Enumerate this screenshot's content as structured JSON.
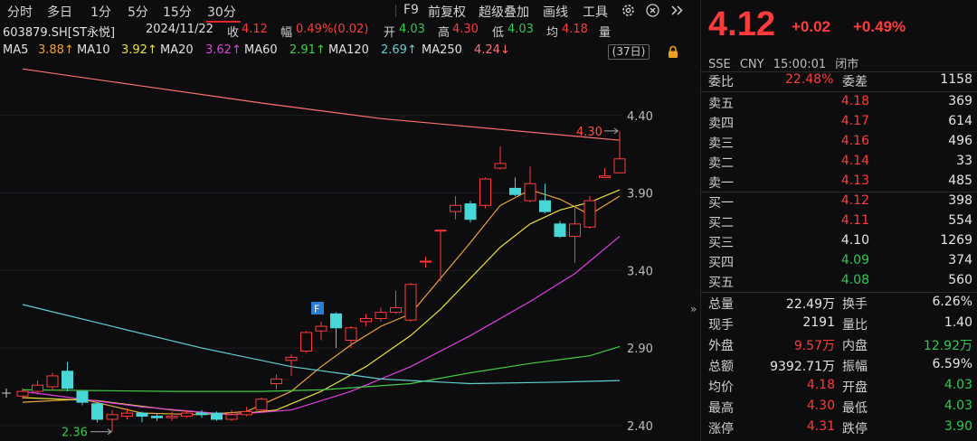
{
  "toolbar": {
    "periods": [
      "分时",
      "多日",
      "1分",
      "5分",
      "15分",
      "30分"
    ],
    "right_items": [
      "F9",
      "前复权",
      "超级叠加",
      "画线",
      "工具"
    ]
  },
  "info": {
    "code": "603879.SH[ST永悦]",
    "date": "2024/11/22",
    "close_label": "收",
    "close_value": "4.12",
    "amp_label": "幅",
    "amp_value": "0.49%(0.02)",
    "open_label": "开",
    "open_value": "4.03",
    "high_label": "高",
    "high_value": "4.30",
    "low_label": "低",
    "low_value": "4.03",
    "avg_label": "均",
    "avg_value": "4.18",
    "vol_label": "量"
  },
  "ma": [
    {
      "label": "MA5",
      "value": "3.88↑",
      "color": "#e8a33c"
    },
    {
      "label": "MA10",
      "value": "3.92↑",
      "color": "#e8e03c"
    },
    {
      "label": "MA20",
      "value": "3.62↑",
      "color": "#e040e0"
    },
    {
      "label": "MA60",
      "value": "2.91↑",
      "color": "#44cc44"
    },
    {
      "label": "MA120",
      "value": "2.69↑",
      "color": "#5fd0d0"
    },
    {
      "label": "MA250",
      "value": "4.24↓",
      "color": "#ff7070"
    }
  ],
  "days_badge": "(37日)",
  "chart_data": {
    "type": "candlestick",
    "y_ticks": [
      "4.40",
      "3.90",
      "3.40",
      "2.90",
      "2.40"
    ],
    "ylim": [
      2.3,
      4.76
    ],
    "high_marker": "4.30",
    "low_marker": "2.36",
    "f_marker": "F",
    "candles": [
      {
        "o": 2.59,
        "c": 2.62,
        "h": 2.64,
        "l": 2.57
      },
      {
        "o": 2.62,
        "c": 2.66,
        "h": 2.69,
        "l": 2.6
      },
      {
        "o": 2.65,
        "c": 2.72,
        "h": 2.74,
        "l": 2.63
      },
      {
        "o": 2.75,
        "c": 2.64,
        "h": 2.81,
        "l": 2.62
      },
      {
        "o": 2.62,
        "c": 2.55,
        "h": 2.63,
        "l": 2.53
      },
      {
        "o": 2.54,
        "c": 2.44,
        "h": 2.55,
        "l": 2.42
      },
      {
        "o": 2.44,
        "c": 2.47,
        "h": 2.5,
        "l": 2.36
      },
      {
        "o": 2.46,
        "c": 2.48,
        "h": 2.51,
        "l": 2.44
      },
      {
        "o": 2.48,
        "c": 2.46,
        "h": 2.49,
        "l": 2.42
      },
      {
        "o": 2.46,
        "c": 2.45,
        "h": 2.48,
        "l": 2.43
      },
      {
        "o": 2.45,
        "c": 2.46,
        "h": 2.49,
        "l": 2.43
      },
      {
        "o": 2.46,
        "c": 2.48,
        "h": 2.5,
        "l": 2.45
      },
      {
        "o": 2.48,
        "c": 2.47,
        "h": 2.5,
        "l": 2.45
      },
      {
        "o": 2.48,
        "c": 2.44,
        "h": 2.49,
        "l": 2.43
      },
      {
        "o": 2.44,
        "c": 2.47,
        "h": 2.5,
        "l": 2.43
      },
      {
        "o": 2.47,
        "c": 2.49,
        "h": 2.52,
        "l": 2.46
      },
      {
        "o": 2.5,
        "c": 2.57,
        "h": 2.58,
        "l": 2.48
      },
      {
        "o": 2.67,
        "c": 2.7,
        "h": 2.73,
        "l": 2.63
      },
      {
        "o": 2.82,
        "c": 2.84,
        "h": 2.86,
        "l": 2.72
      },
      {
        "o": 2.88,
        "c": 3.0,
        "h": 3.01,
        "l": 2.87
      },
      {
        "o": 3.01,
        "c": 3.04,
        "h": 3.07,
        "l": 2.95
      },
      {
        "o": 3.12,
        "c": 3.03,
        "h": 3.13,
        "l": 2.9
      },
      {
        "o": 2.95,
        "c": 3.03,
        "h": 3.04,
        "l": 2.9
      },
      {
        "o": 3.07,
        "c": 3.09,
        "h": 3.12,
        "l": 3.04
      },
      {
        "o": 3.09,
        "c": 3.13,
        "h": 3.16,
        "l": 3.07
      },
      {
        "o": 3.13,
        "c": 3.16,
        "h": 3.27,
        "l": 3.12
      },
      {
        "o": 3.08,
        "c": 3.31,
        "h": 3.32,
        "l": 3.07
      },
      {
        "o": 3.46,
        "c": 3.46,
        "h": 3.49,
        "l": 3.42
      },
      {
        "o": 3.66,
        "c": 3.66,
        "h": 3.66,
        "l": 3.33
      },
      {
        "o": 3.78,
        "c": 3.82,
        "h": 3.88,
        "l": 3.73
      },
      {
        "o": 3.83,
        "c": 3.73,
        "h": 3.85,
        "l": 3.71
      },
      {
        "o": 3.82,
        "c": 3.99,
        "h": 4.0,
        "l": 3.8
      },
      {
        "o": 4.06,
        "c": 4.09,
        "h": 4.2,
        "l": 4.05
      },
      {
        "o": 3.93,
        "c": 3.89,
        "h": 4.0,
        "l": 3.88
      },
      {
        "o": 3.85,
        "c": 3.96,
        "h": 4.07,
        "l": 3.84
      },
      {
        "o": 3.85,
        "c": 3.78,
        "h": 3.96,
        "l": 3.77
      },
      {
        "o": 3.7,
        "c": 3.62,
        "h": 3.72,
        "l": 3.61
      },
      {
        "o": 3.62,
        "c": 3.7,
        "h": 3.82,
        "l": 3.45
      },
      {
        "o": 3.68,
        "c": 3.85,
        "h": 3.88,
        "l": 3.67
      },
      {
        "o": 4.0,
        "c": 4.01,
        "h": 4.06,
        "l": 4.0
      },
      {
        "o": 4.03,
        "c": 4.12,
        "h": 4.3,
        "l": 4.03
      }
    ],
    "ma_lines": [
      {
        "name": "MA5",
        "color": "#e8a33c",
        "points": [
          [
            0,
            2.55
          ],
          [
            4,
            2.57
          ],
          [
            8,
            2.48
          ],
          [
            12,
            2.47
          ],
          [
            15,
            2.49
          ],
          [
            18,
            2.62
          ],
          [
            20,
            2.78
          ],
          [
            22,
            2.92
          ],
          [
            24,
            3.04
          ],
          [
            26,
            3.12
          ],
          [
            28,
            3.35
          ],
          [
            30,
            3.58
          ],
          [
            32,
            3.82
          ],
          [
            34,
            3.92
          ],
          [
            36,
            3.86
          ],
          [
            38,
            3.76
          ],
          [
            40,
            3.88
          ]
        ]
      },
      {
        "name": "MA10",
        "color": "#e8e03c",
        "points": [
          [
            0,
            2.58
          ],
          [
            5,
            2.56
          ],
          [
            10,
            2.5
          ],
          [
            14,
            2.47
          ],
          [
            17,
            2.5
          ],
          [
            20,
            2.62
          ],
          [
            23,
            2.78
          ],
          [
            26,
            2.98
          ],
          [
            28,
            3.15
          ],
          [
            30,
            3.35
          ],
          [
            32,
            3.55
          ],
          [
            34,
            3.7
          ],
          [
            36,
            3.79
          ],
          [
            38,
            3.84
          ],
          [
            40,
            3.92
          ]
        ]
      },
      {
        "name": "MA20",
        "color": "#e040e0",
        "points": [
          [
            0,
            2.62
          ],
          [
            8,
            2.52
          ],
          [
            14,
            2.47
          ],
          [
            18,
            2.5
          ],
          [
            22,
            2.62
          ],
          [
            26,
            2.78
          ],
          [
            30,
            2.98
          ],
          [
            34,
            3.2
          ],
          [
            37,
            3.38
          ],
          [
            40,
            3.62
          ]
        ]
      },
      {
        "name": "MA60",
        "color": "#44cc44",
        "points": [
          [
            0,
            2.63
          ],
          [
            10,
            2.62
          ],
          [
            16,
            2.62
          ],
          [
            20,
            2.63
          ],
          [
            26,
            2.67
          ],
          [
            30,
            2.74
          ],
          [
            34,
            2.8
          ],
          [
            38,
            2.85
          ],
          [
            40,
            2.91
          ]
        ]
      },
      {
        "name": "MA120",
        "color": "#5fd0d0",
        "points": [
          [
            0,
            3.18
          ],
          [
            6,
            3.04
          ],
          [
            12,
            2.9
          ],
          [
            18,
            2.78
          ],
          [
            24,
            2.7
          ],
          [
            30,
            2.67
          ],
          [
            36,
            2.68
          ],
          [
            40,
            2.69
          ]
        ]
      },
      {
        "name": "MA250",
        "color": "#ff7070",
        "points": [
          [
            0,
            4.7
          ],
          [
            8,
            4.59
          ],
          [
            16,
            4.48
          ],
          [
            24,
            4.38
          ],
          [
            32,
            4.31
          ],
          [
            40,
            4.24
          ]
        ]
      }
    ]
  },
  "quote": {
    "price": "4.12",
    "change": "+0.02",
    "change_pct": "+0.49%",
    "market": "SSE",
    "currency": "CNY",
    "time": "15:00:01",
    "status": "闭市",
    "weibi_label": "委比",
    "weibi_value": "22.48%",
    "weicha_label": "委差",
    "weicha_value": "1158",
    "asks": [
      {
        "label": "卖五",
        "price": "4.18",
        "vol": "369",
        "color": "#ff3b3b"
      },
      {
        "label": "卖四",
        "price": "4.17",
        "vol": "614",
        "color": "#ff3b3b"
      },
      {
        "label": "卖三",
        "price": "4.16",
        "vol": "496",
        "color": "#ff3b3b"
      },
      {
        "label": "卖二",
        "price": "4.14",
        "vol": "33",
        "color": "#ff3b3b"
      },
      {
        "label": "卖一",
        "price": "4.13",
        "vol": "485",
        "color": "#ff3b3b"
      }
    ],
    "bids": [
      {
        "label": "买一",
        "price": "4.12",
        "vol": "398",
        "color": "#ff3b3b"
      },
      {
        "label": "买二",
        "price": "4.11",
        "vol": "554",
        "color": "#ff3b3b"
      },
      {
        "label": "买三",
        "price": "4.10",
        "vol": "1269",
        "color": "#e6e6e6"
      },
      {
        "label": "买四",
        "price": "4.09",
        "vol": "374",
        "color": "#32c850"
      },
      {
        "label": "买五",
        "price": "4.08",
        "vol": "560",
        "color": "#32c850"
      }
    ],
    "stats": [
      {
        "l": "总量",
        "v": "22.49万",
        "vc": "#e6e6e6",
        "l2": "换手",
        "v2": "6.26%",
        "v2c": "#e6e6e6"
      },
      {
        "l": "现手",
        "v": "2191",
        "vc": "#e6e6e6",
        "l2": "量比",
        "v2": "1.40",
        "v2c": "#e6e6e6"
      },
      {
        "l": "外盘",
        "v": "9.57万",
        "vc": "#ff3b3b",
        "l2": "内盘",
        "v2": "12.92万",
        "v2c": "#32c850"
      },
      {
        "l": "总额",
        "v": "9392.71万",
        "vc": "#e6e6e6",
        "l2": "振幅",
        "v2": "6.59%",
        "v2c": "#e6e6e6"
      },
      {
        "l": "均价",
        "v": "4.18",
        "vc": "#ff3b3b",
        "l2": "开盘",
        "v2": "4.03",
        "v2c": "#32c850"
      },
      {
        "l": "最高",
        "v": "4.30",
        "vc": "#ff3b3b",
        "l2": "最低",
        "v2": "4.03",
        "v2c": "#32c850"
      },
      {
        "l": "涨停",
        "v": "4.31",
        "vc": "#ff3b3b",
        "l2": "跌停",
        "v2": "3.90",
        "v2c": "#32c850"
      }
    ]
  },
  "colors": {
    "up": "#ff3b3b",
    "down_fill": "#48d6d6",
    "grid": "#1e1e22",
    "axis_text": "#bdbdbd"
  }
}
